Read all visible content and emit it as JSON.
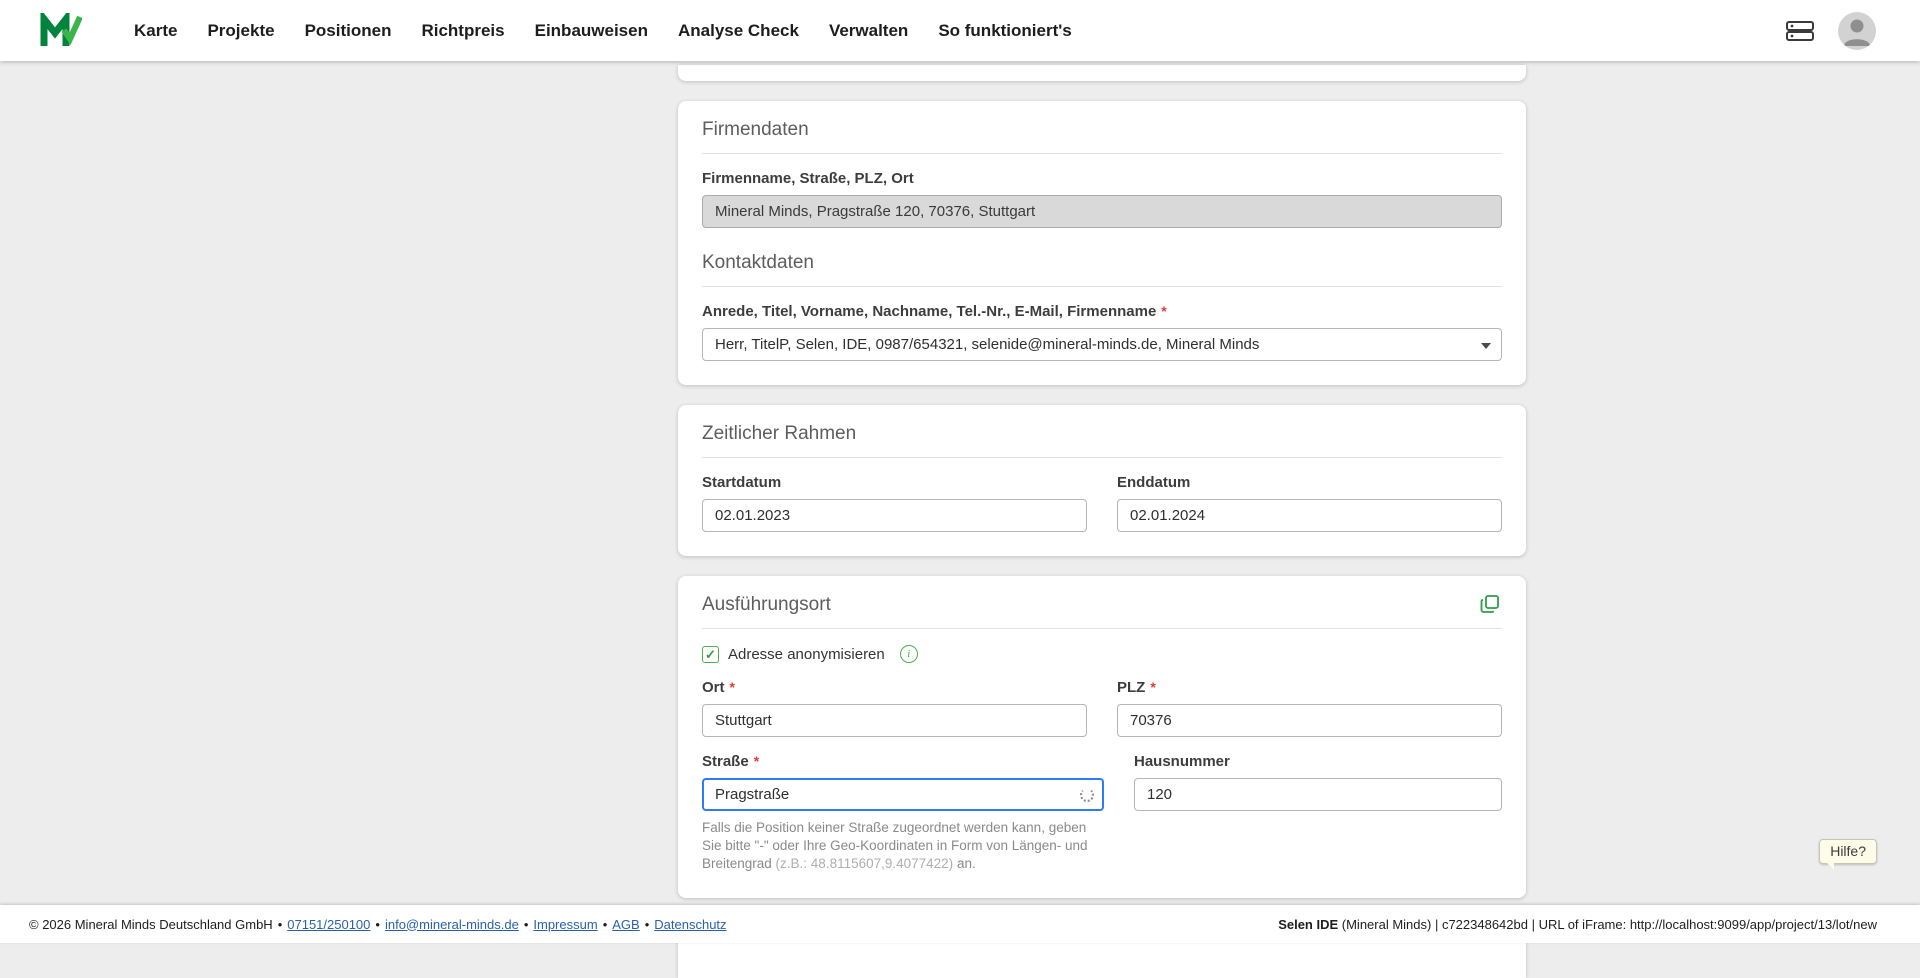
{
  "colors": {
    "accent_green": "#00A34A",
    "focus_blue": "#2E7BF6",
    "link_blue": "#2A5FAD",
    "readonly_gray": "#D9D9D9"
  },
  "nav": {
    "items": [
      "Karte",
      "Projekte",
      "Positionen",
      "Richtpreis",
      "Einbauweisen",
      "Analyse Check",
      "Verwalten",
      "So funktioniert's"
    ]
  },
  "required_marker": "*",
  "sections": {
    "firmendaten": {
      "title": "Firmendaten",
      "company_label": "Firmenname, Straße, PLZ, Ort",
      "company_value": "Mineral Minds, Pragstraße 120, 70376, Stuttgart",
      "kontakt_title": "Kontaktdaten",
      "kontakt_label": "Anrede, Titel, Vorname, Nachname, Tel.-Nr., E-Mail, Firmenname",
      "kontakt_value": "Herr, TitelP, Selen, IDE, 0987/654321, selenide@mineral-minds.de, Mineral Minds"
    },
    "zeitraum": {
      "title": "Zeitlicher Rahmen",
      "start_label": "Startdatum",
      "start_value": "02.01.2023",
      "end_label": "Enddatum",
      "end_value": "02.01.2024"
    },
    "ausfuehrungsort": {
      "title": "Ausführungsort",
      "anonymize_label": "Adresse anonymisieren",
      "ort_label": "Ort",
      "ort_value": "Stuttgart",
      "plz_label": "PLZ",
      "plz_value": "70376",
      "strasse_label": "Straße",
      "strasse_value": "Pragstraße",
      "hausnummer_label": "Hausnummer",
      "hausnummer_value": "120",
      "hint_part1": "Falls die Position keiner Straße zugeordnet werden kann, geben Sie bitte \"-\" oder Ihre Geo-Koordinaten in Form von Längen- und Breitengrad ",
      "hint_example": "(z.B.: 48.8115607,9.4077422)",
      "hint_part3": " an."
    }
  },
  "help": {
    "label": "Hilfe?"
  },
  "footer": {
    "separator": "•",
    "copyright": "© 2026 Mineral Minds Deutschland GmbH",
    "phone": "07151/250100",
    "email": "info@mineral-minds.de",
    "impressum": "Impressum",
    "agb": "AGB",
    "datenschutz": "Datenschutz",
    "right_bold": "Selen IDE",
    "right_rest": " (Mineral Minds) | c722348642bd | URL of iFrame: http://localhost:9099/app/project/13/lot/new"
  }
}
